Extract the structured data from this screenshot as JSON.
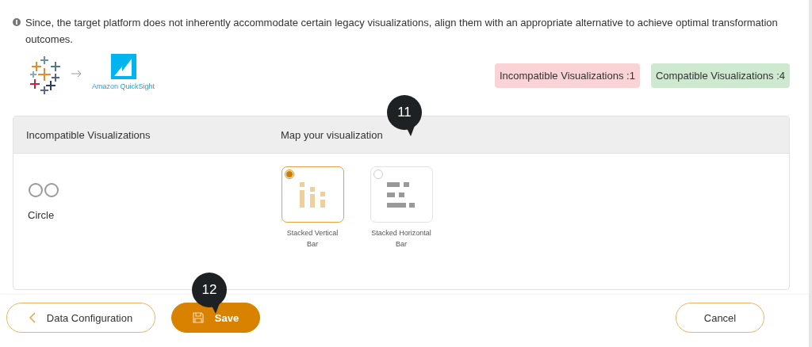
{
  "notice": "Since, the target platform does not inherently accommodate certain legacy visualizations, align them with an appropriate alternative to achieve optimal transformation outcomes.",
  "target_logo_label": "Amazon QuickSight",
  "badges": [
    {
      "label": "Incompatible Visualizations :1",
      "kind": "incompatible"
    },
    {
      "label": "Compatible Visualizations :4",
      "kind": "compatible"
    }
  ],
  "table": {
    "columns": [
      "Incompatible Visualizations",
      "Map your visualization"
    ],
    "rows": [
      {
        "visualization": "Circle",
        "options": [
          {
            "label": "Stacked Vertical Bar",
            "kind": "vertical",
            "selected": true
          },
          {
            "label": "Stacked Horizontal Bar",
            "kind": "horizontal",
            "selected": false
          }
        ]
      }
    ]
  },
  "callouts": [
    {
      "label": "11",
      "kind": "header"
    },
    {
      "label": "12",
      "kind": "save"
    }
  ],
  "footer": {
    "back_button": "Data Configuration",
    "save_button": "Save",
    "cancel_button": "Cancel"
  }
}
